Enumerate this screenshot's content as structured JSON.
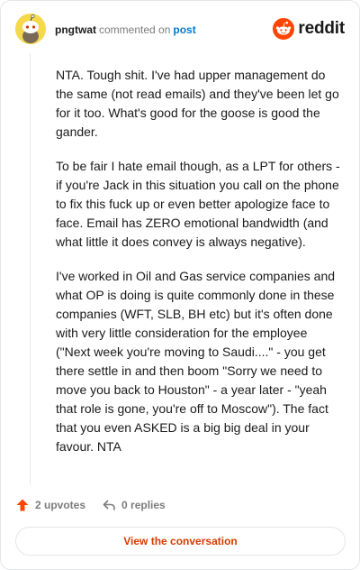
{
  "header": {
    "username": "pngtwat",
    "action": "commented on",
    "post_link": "post",
    "brand": "reddit"
  },
  "comment": {
    "paragraphs": [
      "NTA. Tough shit. I've had upper management do the same (not read emails) and they've been let go for it too. What's good for the goose is good the gander.",
      "To be fair I hate email though, as a LPT for others - if you're Jack in this situation you call on the phone to fix this fuck up or even better apologize face to face. Email has ZERO emotional bandwidth (and what little it does convey is always negative).",
      "I've worked in Oil and Gas service companies and what OP is doing is quite commonly done in these companies (WFT, SLB, BH etc) but it's often done with very little consideration for the employee (\"Next week you're moving to Saudi....\" - you get there settle in and then boom \"Sorry we need to move you back to Houston\" - a year later - \"yeah that role is gone, you're off to Moscow\"). The fact that you even ASKED is a big big deal in your favour. NTA"
    ]
  },
  "footer": {
    "upvotes": "2 upvotes",
    "replies": "0 replies",
    "view_button": "View the conversation"
  },
  "colors": {
    "upvote": "#ff4500",
    "link": "#0079d3",
    "button_text": "#d93a00",
    "avatar": "#f5d94d"
  }
}
